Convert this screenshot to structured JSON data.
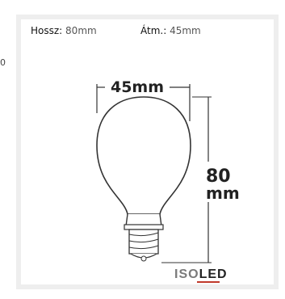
{
  "stray_text": "0",
  "specs": {
    "length_label": "Hossz:",
    "length_value": "80mm",
    "diameter_label": "Átm.:",
    "diameter_value": "45mm"
  },
  "diagram": {
    "width_label": "45mm",
    "height_label_value": "80",
    "height_label_unit": "mm"
  },
  "brand": {
    "part1": "ISO",
    "part2": "LED",
    "color_part1": "#7a7a7a",
    "color_part2": "#222222",
    "underline_color": "#c0392b"
  }
}
